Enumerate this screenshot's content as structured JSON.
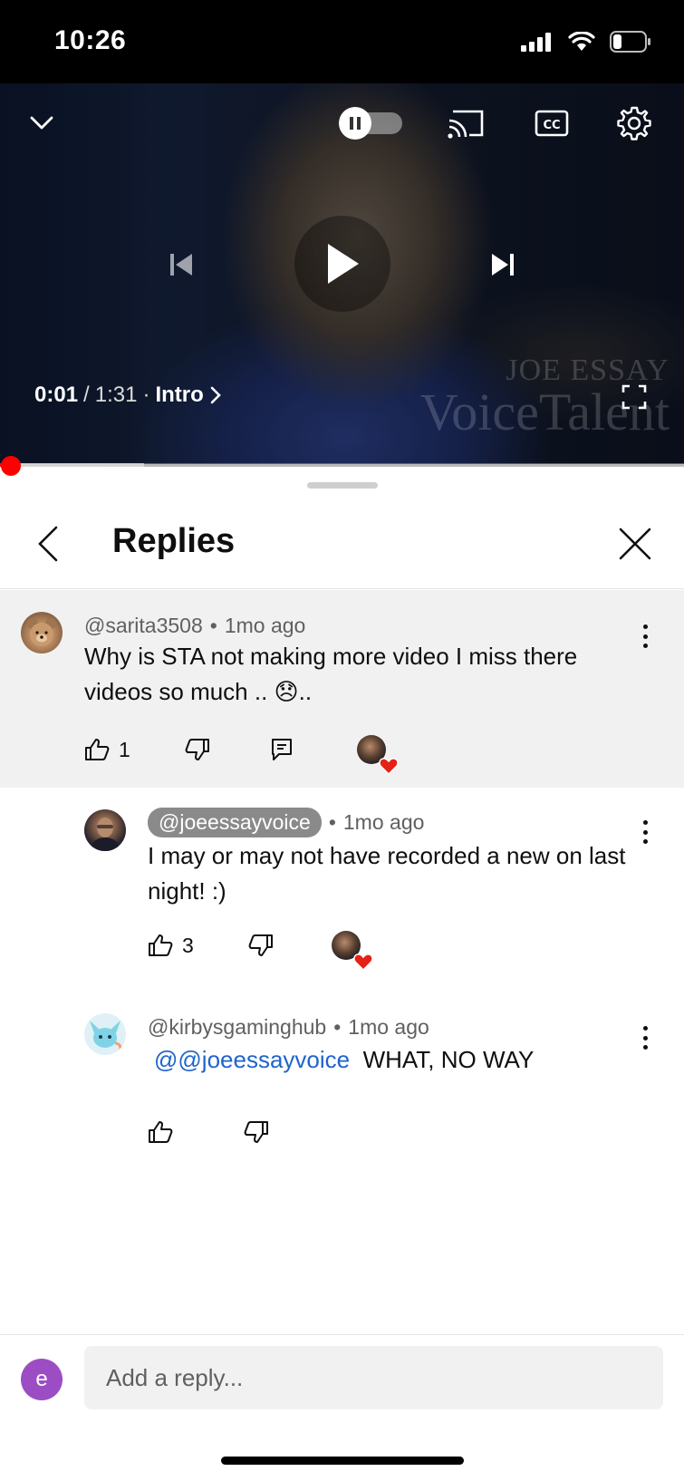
{
  "status_bar": {
    "time": "10:26"
  },
  "player": {
    "current_time": "0:01",
    "separator": "/",
    "duration": "1:31",
    "chapter_prefix": "·",
    "chapter": "Intro",
    "watermark_line1": "JOE ESSAY",
    "watermark_line2": "VoiceTalent",
    "progress_fraction": 0.011,
    "buffer_fraction": 0.21,
    "accent_color": "#ff0000"
  },
  "sheet": {
    "title": "Replies"
  },
  "comments": [
    {
      "author": "@sarita3508",
      "time": "1mo ago",
      "text": "Why is STA not making more video I miss there videos so much .. 😞..",
      "likes": "1"
    },
    {
      "author": "@joeessayvoice",
      "time": "1mo ago",
      "text": "I may or may not have recorded a new on last night! :)",
      "likes": "3"
    },
    {
      "author": "@kirbysgaminghub",
      "time": "1mo ago",
      "mention": "@@joeessayvoice",
      "text": "WHAT, NO WAY"
    }
  ],
  "meta_separator": "•",
  "reply_bar": {
    "avatar_letter": "e",
    "placeholder": "Add a reply..."
  }
}
